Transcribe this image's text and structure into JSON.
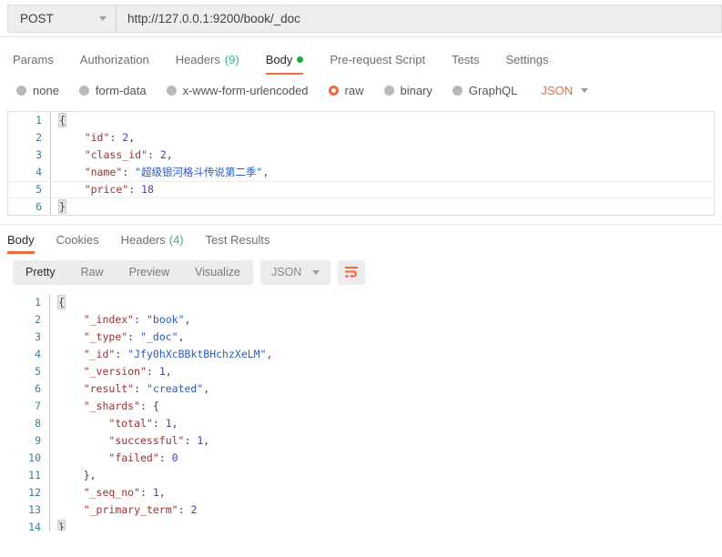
{
  "url_bar": {
    "method": "POST",
    "method_icon": "chevron-down-icon",
    "url": "http://127.0.0.1:9200/book/_doc"
  },
  "request_tabs": [
    {
      "label": "Params",
      "active": false
    },
    {
      "label": "Authorization",
      "active": false
    },
    {
      "label": "Headers",
      "count": "(9)",
      "active": false
    },
    {
      "label": "Body",
      "active": true,
      "indicator": "green-dot"
    },
    {
      "label": "Pre-request Script",
      "active": false
    },
    {
      "label": "Tests",
      "active": false
    },
    {
      "label": "Settings",
      "active": false
    }
  ],
  "body_type": {
    "options": [
      {
        "label": "none",
        "selected": false
      },
      {
        "label": "form-data",
        "selected": false
      },
      {
        "label": "x-www-form-urlencoded",
        "selected": false
      },
      {
        "label": "raw",
        "selected": true
      },
      {
        "label": "binary",
        "selected": false
      },
      {
        "label": "GraphQL",
        "selected": false
      }
    ],
    "format": "JSON",
    "format_icon": "chevron-down-icon"
  },
  "request_body": {
    "lines": [
      {
        "no": "1",
        "text": "{"
      },
      {
        "no": "2",
        "text": "    \"id\": 2,"
      },
      {
        "no": "3",
        "text": "    \"class_id\": 2,"
      },
      {
        "no": "4",
        "text": "    \"name\": \"超级银河格斗传说第二季\","
      },
      {
        "no": "5",
        "text": "    \"price\": 18",
        "highlight": true
      },
      {
        "no": "6",
        "text": "}"
      }
    ]
  },
  "response_tabs": [
    {
      "label": "Body",
      "active": true
    },
    {
      "label": "Cookies",
      "active": false
    },
    {
      "label": "Headers",
      "count": "(4)",
      "active": false
    },
    {
      "label": "Test Results",
      "active": false
    }
  ],
  "response_toolbar": {
    "views": [
      {
        "label": "Pretty",
        "active": true
      },
      {
        "label": "Raw",
        "active": false
      },
      {
        "label": "Preview",
        "active": false
      },
      {
        "label": "Visualize",
        "active": false
      }
    ],
    "format": "JSON",
    "format_icon": "chevron-down-icon",
    "wrap_icon": "wrap-text-icon"
  },
  "response_body": {
    "lines": [
      {
        "no": "1",
        "text": "{"
      },
      {
        "no": "2",
        "text": "    \"_index\": \"book\","
      },
      {
        "no": "3",
        "text": "    \"_type\": \"_doc\","
      },
      {
        "no": "4",
        "text": "    \"_id\": \"Jfy0hXcBBktBHchzXeLM\","
      },
      {
        "no": "5",
        "text": "    \"_version\": 1,"
      },
      {
        "no": "6",
        "text": "    \"result\": \"created\","
      },
      {
        "no": "7",
        "text": "    \"_shards\": {"
      },
      {
        "no": "8",
        "text": "        \"total\": 1,"
      },
      {
        "no": "9",
        "text": "        \"successful\": 1,"
      },
      {
        "no": "10",
        "text": "        \"failed\": 0"
      },
      {
        "no": "11",
        "text": "    },"
      },
      {
        "no": "12",
        "text": "    \"_seq_no\": 1,"
      },
      {
        "no": "13",
        "text": "    \"_primary_term\": 2"
      },
      {
        "no": "14",
        "text": "}"
      }
    ]
  },
  "colors": {
    "accent": "#ef6c3e",
    "green": "#26a148",
    "key": "#a03030",
    "string": "#2a59c9",
    "number": "#4a3fb0",
    "gutter": "#3d7e9a"
  }
}
